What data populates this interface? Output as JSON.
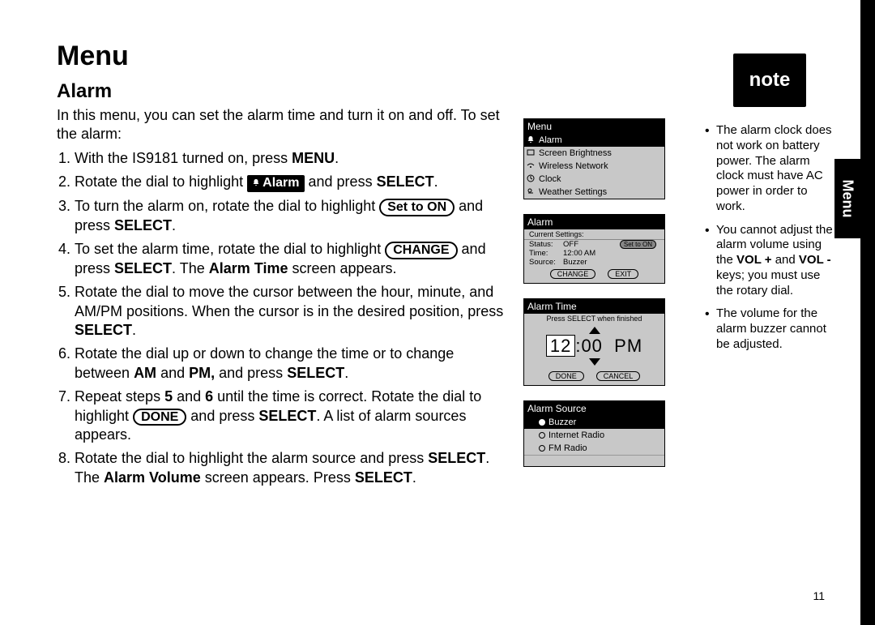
{
  "page": {
    "title": "Menu",
    "section": "Alarm",
    "tab": "Menu",
    "number": "11"
  },
  "intro": "In this menu, you can set the alarm time and turn it on and off. To set the alarm:",
  "steps": {
    "s1a": "With the IS9181 turned on, press ",
    "s1b": "MENU",
    "s1c": ".",
    "s2a": "Rotate the dial to highlight ",
    "s2chip": "Alarm",
    "s2b": " and press ",
    "s2c": "SELECT",
    "s2d": ".",
    "s3a": "To turn the alarm on, rotate the dial to highlight ",
    "s3pill": "Set to ON",
    "s3b": " and press ",
    "s3c": "SELECT",
    "s3d": ".",
    "s4a": "To set the alarm time, rotate the dial to highlight ",
    "s4pill": "CHANGE",
    "s4b": " and press ",
    "s4c": "SELECT",
    "s4d": ". The ",
    "s4e": "Alarm Time",
    "s4f": " screen appears.",
    "s5a": "Rotate the dial to move the cursor between the hour, minute, and AM/PM positions. When the cursor is in the desired position, press ",
    "s5b": "SELECT",
    "s5c": ".",
    "s6a": "Rotate the dial up or down to change the time or to change between ",
    "s6b": "AM",
    "s6c": " and ",
    "s6d": "PM,",
    "s6e": " and press ",
    "s6f": "SELECT",
    "s6g": ".",
    "s7a": "Repeat steps ",
    "s7b": "5",
    "s7c": " and ",
    "s7d": "6",
    "s7e": " until the time is correct. Rotate the dial to highlight ",
    "s7pill": "DONE",
    "s7f": " and press ",
    "s7g": "SELECT",
    "s7h": ". A list of alarm sources appears.",
    "s8a": "Rotate the dial to highlight the alarm source and press ",
    "s8b": "SELECT",
    "s8c": ". The ",
    "s8d": "Alarm Volume",
    "s8e": " screen appears. Press ",
    "s8f": "SELECT",
    "s8g": "."
  },
  "screens": {
    "menu": {
      "title": "Menu",
      "items": [
        "Alarm",
        "Screen Brightness",
        "Wireless Network",
        "Clock",
        "Weather Settings"
      ]
    },
    "alarm": {
      "title": "Alarm",
      "subtitle": "Current Settings:",
      "status_k": "Status:",
      "status_v": "OFF",
      "time_k": "Time:",
      "time_v": "12:00 AM",
      "source_k": "Source:",
      "source_v": "Buzzer",
      "set_to_on": "Set to ON",
      "change": "CHANGE",
      "exit": "EXIT"
    },
    "alarm_time": {
      "title": "Alarm Time",
      "hint": "Press SELECT when finished",
      "hh": "12",
      "mm": ":00",
      "ampm": "PM",
      "done": "DONE",
      "cancel": "CANCEL"
    },
    "alarm_source": {
      "title": "Alarm Source",
      "items": [
        "Buzzer",
        "Internet Radio",
        "FM Radio"
      ]
    }
  },
  "note": {
    "label": "note",
    "items": {
      "n1": "The alarm clock does not work on battery power. The alarm clock must have AC power in order to work.",
      "n2a": "You cannot adjust the alarm volume using the ",
      "n2b": "VOL +",
      "n2c": " and ",
      "n2d": "VOL -",
      "n2e": "  keys; you must use the rotary dial.",
      "n3": "The volume for the alarm buzzer cannot be adjusted."
    }
  }
}
